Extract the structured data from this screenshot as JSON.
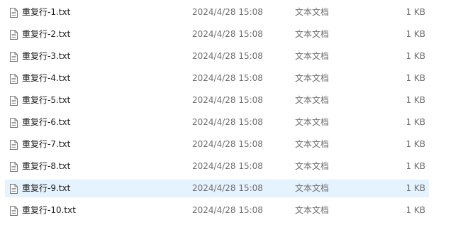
{
  "files": [
    {
      "name": "重复行-1.txt",
      "date": "2024/4/28 15:08",
      "type": "文本文档",
      "size": "1 KB",
      "selected": false
    },
    {
      "name": "重复行-2.txt",
      "date": "2024/4/28 15:08",
      "type": "文本文档",
      "size": "1 KB",
      "selected": false
    },
    {
      "name": "重复行-3.txt",
      "date": "2024/4/28 15:08",
      "type": "文本文档",
      "size": "1 KB",
      "selected": false
    },
    {
      "name": "重复行-4.txt",
      "date": "2024/4/28 15:08",
      "type": "文本文档",
      "size": "1 KB",
      "selected": false
    },
    {
      "name": "重复行-5.txt",
      "date": "2024/4/28 15:08",
      "type": "文本文档",
      "size": "1 KB",
      "selected": false
    },
    {
      "name": "重复行-6.txt",
      "date": "2024/4/28 15:08",
      "type": "文本文档",
      "size": "1 KB",
      "selected": false
    },
    {
      "name": "重复行-7.txt",
      "date": "2024/4/28 15:08",
      "type": "文本文档",
      "size": "1 KB",
      "selected": false
    },
    {
      "name": "重复行-8.txt",
      "date": "2024/4/28 15:08",
      "type": "文本文档",
      "size": "1 KB",
      "selected": false
    },
    {
      "name": "重复行-9.txt",
      "date": "2024/4/28 15:08",
      "type": "文本文档",
      "size": "1 KB",
      "selected": true
    },
    {
      "name": "重复行-10.txt",
      "date": "2024/4/28 15:08",
      "type": "文本文档",
      "size": "1 KB",
      "selected": false
    }
  ],
  "icon": "text-document-icon",
  "colors": {
    "selected_row_bg": "#e5f3ff",
    "secondary_text": "#6d6d6d"
  }
}
